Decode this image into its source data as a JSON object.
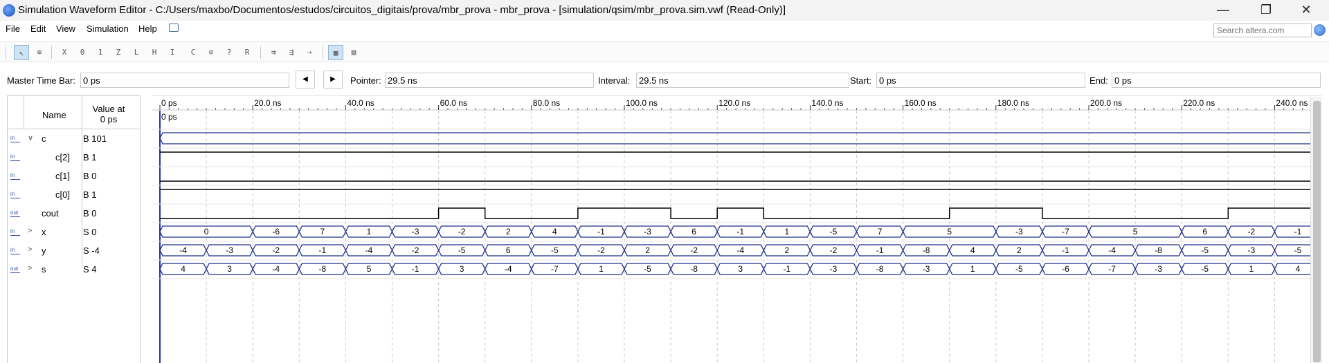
{
  "window": {
    "title": "Simulation Waveform Editor - C:/Users/maxbo/Documentos/estudos/circuitos_digitais/prova/mbr_prova - mbr_prova - [simulation/qsim/mbr_prova.sim.vwf (Read-Only)]",
    "minimize": "—",
    "restore": "❐",
    "close": "✕"
  },
  "menu": {
    "file": "File",
    "edit": "Edit",
    "view": "View",
    "simulation": "Simulation",
    "help": "Help"
  },
  "search": {
    "placeholder": "Search altera.com"
  },
  "timebar": {
    "master_label": "Master Time Bar:",
    "master_value": "0 ps",
    "prev": "◀",
    "next": "▶",
    "pointer_label": "Pointer:",
    "pointer_value": "29.5 ns",
    "interval_label": "Interval:",
    "interval_value": "29.5 ns",
    "start_label": "Start:",
    "start_value": "0 ps",
    "end_label": "End:",
    "end_value": "0 ps"
  },
  "header": {
    "name": "Name",
    "value_at_1": "Value at",
    "value_at_2": "0 ps"
  },
  "signals": [
    {
      "icon": "in",
      "expand": "∨",
      "name": "c",
      "value": "B 101"
    },
    {
      "icon": "in",
      "expand": "",
      "name": "c[2]",
      "value": "B 1"
    },
    {
      "icon": "in",
      "expand": "",
      "name": "c[1]",
      "value": "B 0"
    },
    {
      "icon": "in",
      "expand": "",
      "name": "c[0]",
      "value": "B 1"
    },
    {
      "icon": "out",
      "expand": "",
      "name": "cout",
      "value": "B 0"
    },
    {
      "icon": "in",
      "expand": ">",
      "name": "x",
      "value": "S 0"
    },
    {
      "icon": "in",
      "expand": ">",
      "name": "y",
      "value": "S -4"
    },
    {
      "icon": "out",
      "expand": ">",
      "name": "s",
      "value": "S 4"
    }
  ],
  "timeline": {
    "ticks": [
      "0 ps",
      "20.0 ns",
      "40.0 ns",
      "60.0 ns",
      "80.0 ns",
      "100.0 ns",
      "120.0 ns",
      "140.0 ns",
      "160.0 ns",
      "180.0 ns",
      "200.0 ns",
      "220.0 ns",
      "240.0 ns"
    ],
    "marker_label": "0 ps",
    "cout_segments": [
      [
        0,
        60,
        0
      ],
      [
        60,
        70,
        1
      ],
      [
        70,
        90,
        0
      ],
      [
        90,
        110,
        1
      ],
      [
        110,
        120,
        0
      ],
      [
        120,
        130,
        1
      ],
      [
        130,
        170,
        0
      ],
      [
        170,
        190,
        1
      ],
      [
        190,
        230,
        0
      ],
      [
        230,
        250,
        1
      ]
    ],
    "x_segments": [
      [
        0,
        20,
        "0"
      ],
      [
        20,
        30,
        "-6"
      ],
      [
        30,
        40,
        "7"
      ],
      [
        40,
        50,
        "1"
      ],
      [
        50,
        60,
        "-3"
      ],
      [
        60,
        70,
        "-2"
      ],
      [
        70,
        80,
        "2"
      ],
      [
        80,
        90,
        "4"
      ],
      [
        90,
        100,
        "-1"
      ],
      [
        100,
        110,
        "-3"
      ],
      [
        110,
        120,
        "6"
      ],
      [
        120,
        130,
        "-1"
      ],
      [
        130,
        140,
        "1"
      ],
      [
        140,
        150,
        "-5"
      ],
      [
        150,
        160,
        "7"
      ],
      [
        160,
        180,
        "5"
      ],
      [
        180,
        190,
        "-3"
      ],
      [
        190,
        200,
        "-7"
      ],
      [
        200,
        220,
        "5"
      ],
      [
        220,
        230,
        "6"
      ],
      [
        230,
        240,
        "-2"
      ],
      [
        240,
        250,
        "-1"
      ]
    ],
    "y_segments": [
      [
        0,
        10,
        "-4"
      ],
      [
        10,
        20,
        "-3"
      ],
      [
        20,
        30,
        "-2"
      ],
      [
        30,
        40,
        "-1"
      ],
      [
        40,
        50,
        "-4"
      ],
      [
        50,
        60,
        "-2"
      ],
      [
        60,
        70,
        "-5"
      ],
      [
        70,
        80,
        "6"
      ],
      [
        80,
        90,
        "-5"
      ],
      [
        90,
        100,
        "-2"
      ],
      [
        100,
        110,
        "2"
      ],
      [
        110,
        120,
        "-2"
      ],
      [
        120,
        130,
        "-4"
      ],
      [
        130,
        140,
        "2"
      ],
      [
        140,
        150,
        "-2"
      ],
      [
        150,
        160,
        "-1"
      ],
      [
        160,
        170,
        "-8"
      ],
      [
        170,
        180,
        "4"
      ],
      [
        180,
        190,
        "2"
      ],
      [
        190,
        200,
        "-1"
      ],
      [
        200,
        210,
        "-4"
      ],
      [
        210,
        220,
        "-8"
      ],
      [
        220,
        230,
        "-5"
      ],
      [
        230,
        240,
        "-3"
      ],
      [
        240,
        250,
        "-5"
      ]
    ],
    "s_segments": [
      [
        0,
        10,
        "4"
      ],
      [
        10,
        20,
        "3"
      ],
      [
        20,
        30,
        "-4"
      ],
      [
        30,
        40,
        "-8"
      ],
      [
        40,
        50,
        "5"
      ],
      [
        50,
        60,
        "-1"
      ],
      [
        60,
        70,
        "3"
      ],
      [
        70,
        80,
        "-4"
      ],
      [
        80,
        90,
        "-7"
      ],
      [
        90,
        100,
        "1"
      ],
      [
        100,
        110,
        "-5"
      ],
      [
        110,
        120,
        "-8"
      ],
      [
        120,
        130,
        "3"
      ],
      [
        130,
        140,
        "-1"
      ],
      [
        140,
        150,
        "-3"
      ],
      [
        150,
        160,
        "-8"
      ],
      [
        160,
        170,
        "-3"
      ],
      [
        170,
        180,
        "1"
      ],
      [
        180,
        190,
        "-5"
      ],
      [
        190,
        200,
        "-6"
      ],
      [
        200,
        210,
        "-7"
      ],
      [
        210,
        220,
        "-3"
      ],
      [
        220,
        230,
        "-5"
      ],
      [
        230,
        240,
        "1"
      ],
      [
        240,
        250,
        "4"
      ]
    ]
  },
  "colors": {
    "wave": "#1f2d8c",
    "grid": "#c8c8c8",
    "cursor": "#2233aa"
  }
}
